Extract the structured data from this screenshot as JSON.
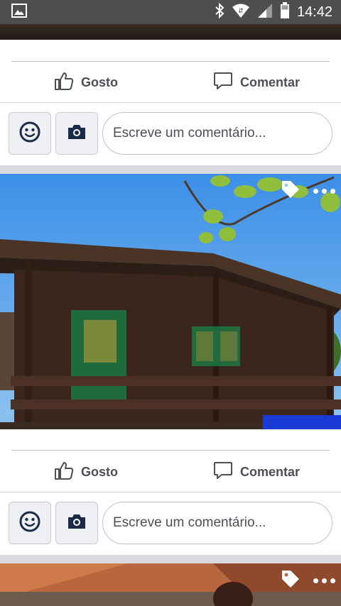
{
  "status_bar": {
    "time": "14:42",
    "icons": [
      "image-icon",
      "bluetooth-icon",
      "wifi-icon",
      "signal-icon",
      "battery-icon"
    ]
  },
  "posts": [
    {
      "actions": {
        "like_label": "Gosto",
        "comment_label": "Comentar"
      },
      "comment_placeholder": "Escreve um comentário..."
    },
    {
      "photo": {
        "subject": "wooden-cabin-photo"
      },
      "actions": {
        "like_label": "Gosto",
        "comment_label": "Comentar"
      },
      "comment_placeholder": "Escreve um comentário..."
    },
    {
      "photo": {
        "subject": "interior-photo"
      }
    }
  ],
  "colors": {
    "status_bar": "#4e4e4e",
    "text": "#4b4f56",
    "icon_dark": "#1c2b4a",
    "feed_bg": "#d9dadd"
  }
}
